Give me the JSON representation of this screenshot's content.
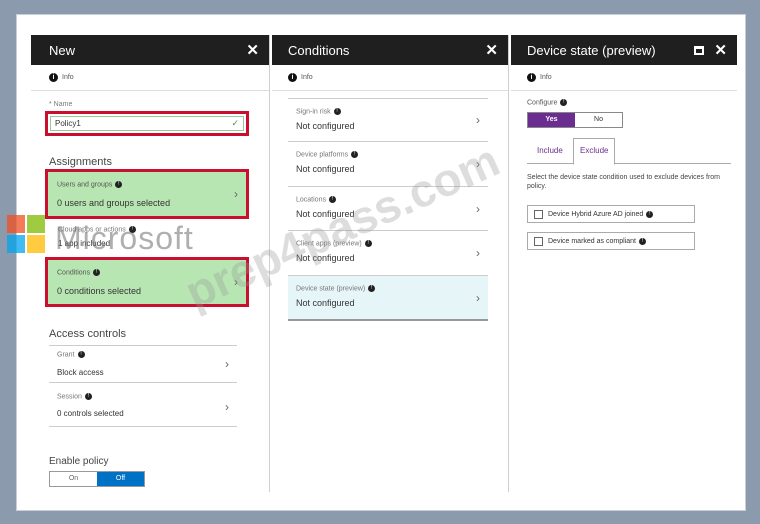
{
  "info_label": "Info",
  "blade_new": {
    "title": "New",
    "name_label": "* Name",
    "name_value": "Policy1",
    "assignments_title": "Assignments",
    "users": {
      "label": "Users and groups",
      "value": "0 users and groups selected"
    },
    "cloud_apps": {
      "label": "Cloud apps or actions",
      "value": "1 app included"
    },
    "conditions": {
      "label": "Conditions",
      "value": "0  conditions  selected"
    },
    "access_title": "Access controls",
    "grant": {
      "label": "Grant",
      "value": "Block access"
    },
    "session": {
      "label": "Session",
      "value": "0 controls selected"
    },
    "enable_title": "Enable policy",
    "toggle_on": "On",
    "toggle_off": "Off"
  },
  "blade_conditions": {
    "title": "Conditions",
    "items": [
      {
        "label": "Sign-in risk",
        "value": "Not configured"
      },
      {
        "label": "Device platforms",
        "value": "Not configured"
      },
      {
        "label": "Locations",
        "value": "Not configured"
      },
      {
        "label": "Client apps (preview)",
        "value": "Not configured"
      },
      {
        "label": "Device state (preview)",
        "value": "Not configured"
      }
    ]
  },
  "blade_device": {
    "title": "Device state (preview)",
    "configure_label": "Configure",
    "yes": "Yes",
    "no": "No",
    "tab_include": "Include",
    "tab_exclude": "Exclude",
    "description": "Select the device state condition used to exclude devices from policy.",
    "options": [
      {
        "label": "Device Hybrid Azure AD joined"
      },
      {
        "label": "Device marked as compliant"
      }
    ]
  },
  "watermarks": {
    "logo": "Microsoft",
    "site": "prep4pass.com"
  },
  "colors": {
    "accent": "#6b2d8f",
    "toggle_blue": "#0072c6",
    "red_outline": "#c8102e",
    "green_fill": "#b8e6b3",
    "header": "#1f1f1f"
  }
}
